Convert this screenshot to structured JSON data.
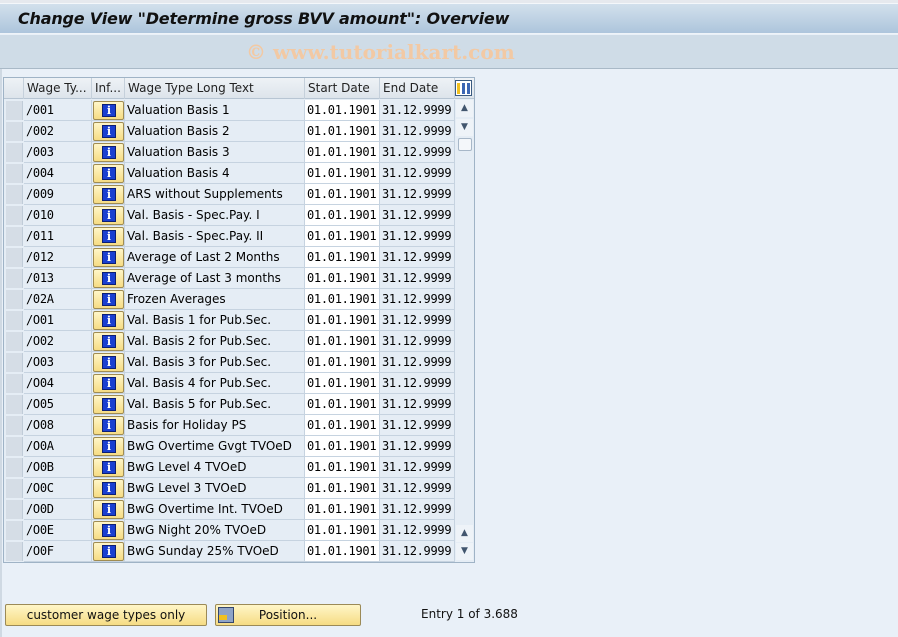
{
  "window": {
    "title": "Change View \"Determine gross BVV amount\": Overview",
    "watermark": "© www.tutorialkart.com"
  },
  "table": {
    "columns": [
      {
        "key": "wage_type",
        "label": "Wage Ty..."
      },
      {
        "key": "info",
        "label": "Inf..."
      },
      {
        "key": "long_text",
        "label": "Wage Type Long Text"
      },
      {
        "key": "start_date",
        "label": "Start Date"
      },
      {
        "key": "end_date",
        "label": "End Date"
      }
    ],
    "column_config_icon": "table-settings-icon",
    "info_icon": "info-icon",
    "info_glyph": "i",
    "rows": [
      {
        "wage_type": "/001",
        "long_text": "Valuation Basis 1",
        "start_date": "01.01.1901",
        "end_date": "31.12.9999"
      },
      {
        "wage_type": "/002",
        "long_text": "Valuation Basis 2",
        "start_date": "01.01.1901",
        "end_date": "31.12.9999"
      },
      {
        "wage_type": "/003",
        "long_text": "Valuation Basis 3",
        "start_date": "01.01.1901",
        "end_date": "31.12.9999"
      },
      {
        "wage_type": "/004",
        "long_text": "Valuation Basis 4",
        "start_date": "01.01.1901",
        "end_date": "31.12.9999"
      },
      {
        "wage_type": "/009",
        "long_text": "ARS without Supplements",
        "start_date": "01.01.1901",
        "end_date": "31.12.9999"
      },
      {
        "wage_type": "/010",
        "long_text": "Val. Basis - Spec.Pay. I",
        "start_date": "01.01.1901",
        "end_date": "31.12.9999"
      },
      {
        "wage_type": "/011",
        "long_text": "Val. Basis - Spec.Pay. II",
        "start_date": "01.01.1901",
        "end_date": "31.12.9999"
      },
      {
        "wage_type": "/012",
        "long_text": "Average of Last 2 Months",
        "start_date": "01.01.1901",
        "end_date": "31.12.9999"
      },
      {
        "wage_type": "/013",
        "long_text": "Average of Last 3 months",
        "start_date": "01.01.1901",
        "end_date": "31.12.9999"
      },
      {
        "wage_type": "/02A",
        "long_text": "Frozen Averages",
        "start_date": "01.01.1901",
        "end_date": "31.12.9999"
      },
      {
        "wage_type": "/O01",
        "long_text": "Val. Basis 1 for Pub.Sec.",
        "start_date": "01.01.1901",
        "end_date": "31.12.9999"
      },
      {
        "wage_type": "/O02",
        "long_text": "Val. Basis 2 for Pub.Sec.",
        "start_date": "01.01.1901",
        "end_date": "31.12.9999"
      },
      {
        "wage_type": "/O03",
        "long_text": "Val. Basis 3 for Pub.Sec.",
        "start_date": "01.01.1901",
        "end_date": "31.12.9999"
      },
      {
        "wage_type": "/O04",
        "long_text": "Val. Basis 4 for Pub.Sec.",
        "start_date": "01.01.1901",
        "end_date": "31.12.9999"
      },
      {
        "wage_type": "/O05",
        "long_text": "Val. Basis 5 for Pub.Sec.",
        "start_date": "01.01.1901",
        "end_date": "31.12.9999"
      },
      {
        "wage_type": "/O08",
        "long_text": "Basis for Holiday PS",
        "start_date": "01.01.1901",
        "end_date": "31.12.9999"
      },
      {
        "wage_type": "/O0A",
        "long_text": "BwG Overtime Gvgt TVOeD",
        "start_date": "01.01.1901",
        "end_date": "31.12.9999"
      },
      {
        "wage_type": "/O0B",
        "long_text": "BwG Level 4 TVOeD",
        "start_date": "01.01.1901",
        "end_date": "31.12.9999"
      },
      {
        "wage_type": "/O0C",
        "long_text": "BwG Level 3 TVOeD",
        "start_date": "01.01.1901",
        "end_date": "31.12.9999"
      },
      {
        "wage_type": "/O0D",
        "long_text": "BwG Overtime Int. TVOeD",
        "start_date": "01.01.1901",
        "end_date": "31.12.9999"
      },
      {
        "wage_type": "/O0E",
        "long_text": "BwG Night 20% TVOeD",
        "start_date": "01.01.1901",
        "end_date": "31.12.9999"
      },
      {
        "wage_type": "/O0F",
        "long_text": "BwG Sunday 25% TVOeD",
        "start_date": "01.01.1901",
        "end_date": "31.12.9999"
      }
    ],
    "scroll": {
      "up_glyph": "▲",
      "down_glyph": "▼"
    }
  },
  "footer": {
    "customer_button_label": "customer wage types only",
    "position_button_label": "Position...",
    "entry_text": "Entry 1 of 3.688"
  },
  "colors": {
    "button_yellow": "#f6dc84",
    "info_icon_blue": "#1a3fd0",
    "header_blue": "#adc5dc",
    "watermark": "#f2c9a4"
  }
}
